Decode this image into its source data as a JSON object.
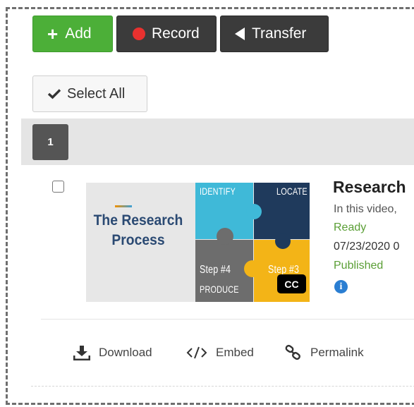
{
  "toolbar": {
    "add_label": "Add",
    "record_label": "Record",
    "transfer_label": "Transfer",
    "select_all_label": "Select All"
  },
  "pagination": {
    "current_page": "1"
  },
  "media_item": {
    "thumbnail": {
      "title_line1": "The Research",
      "title_line2": "Process",
      "puzzle_identify": "IDENTIFY",
      "puzzle_locate": "LOCATE",
      "puzzle_step4": "Step #4",
      "puzzle_produce": "PRODUCE",
      "puzzle_step3": "Step #3",
      "cc_badge": "CC"
    },
    "title": "Research",
    "description": "In this video,",
    "status": "Ready",
    "date": "07/23/2020 0",
    "publish_status": "Published"
  },
  "actions": {
    "download_label": "Download",
    "embed_label": "Embed",
    "permalink_label": "Permalink"
  },
  "colors": {
    "add_green": "#4caf38",
    "dark_button": "#3b3b3b",
    "record_red": "#e8312f",
    "status_green": "#5a9e35",
    "info_blue": "#2a7ed2",
    "puzzle_cyan": "#3fb9d8",
    "puzzle_navy": "#1f3a5c",
    "puzzle_gray": "#6d6d6d",
    "puzzle_yellow": "#f3b417"
  },
  "icons": [
    "plus-icon",
    "record-dot-icon",
    "transfer-arrow-icon",
    "check-icon",
    "cc-icon",
    "info-icon",
    "download-icon",
    "embed-icon",
    "permalink-icon"
  ]
}
